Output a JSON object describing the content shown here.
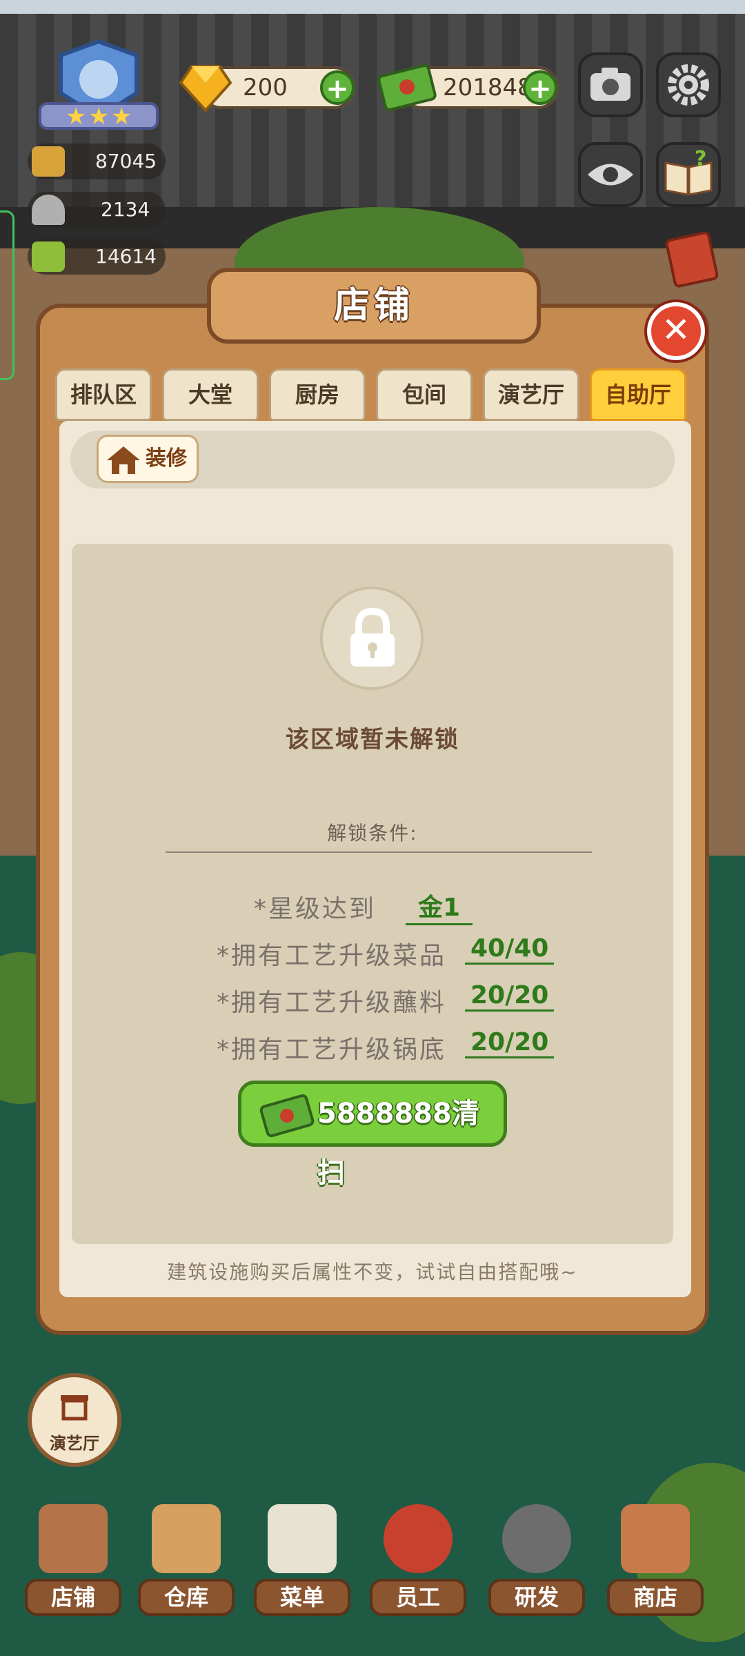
{
  "top_bar": {
    "gems": "200",
    "cash": "201848",
    "stats": {
      "pots": "87045",
      "service": "2134",
      "recipes": "14614"
    }
  },
  "dialog": {
    "title": "店铺",
    "close_label": "✕",
    "tabs": [
      "排队区",
      "大堂",
      "厨房",
      "包间",
      "演艺厅",
      "自助厅"
    ],
    "active_tab": "自助厅",
    "decorate_label": "装修",
    "locked_message": "该区域暂未解锁",
    "conditions_heading": "解锁条件:",
    "conditions": [
      {
        "label": "*星级达到",
        "value": "金1"
      },
      {
        "label": "*拥有工艺升级菜品",
        "value": "40/40"
      },
      {
        "label": "*拥有工艺升级蘸料",
        "value": "20/20"
      },
      {
        "label": "*拥有工艺升级锅底",
        "value": "20/20"
      }
    ],
    "clear_button": "5888888清扫",
    "footnote": "建筑设施购买后属性不变，试试自由搭配哦~"
  },
  "floating_button": "演艺厅",
  "bottom_nav": [
    "店铺",
    "仓库",
    "菜单",
    "员工",
    "研发",
    "商店"
  ],
  "colors": {
    "panel_wood": "#c48a4f",
    "active_tab": "#ffcf3e",
    "accent_green": "#7bcf3c",
    "close_red": "#e4472f"
  }
}
